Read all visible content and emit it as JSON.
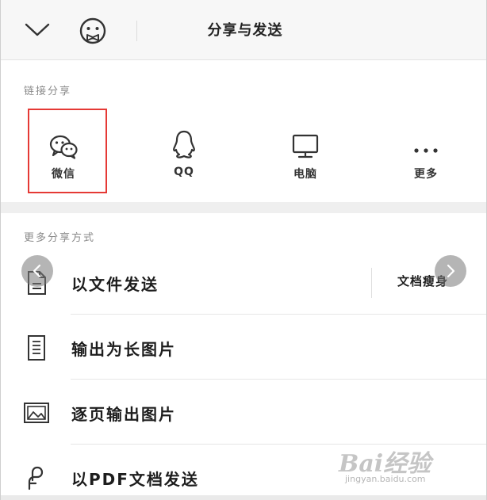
{
  "header": {
    "title": "分享与发送"
  },
  "link_share": {
    "section_label": "链接分享",
    "items": [
      {
        "label": "微信",
        "icon": "wechat-icon"
      },
      {
        "label": "QQ",
        "icon": "qq-icon"
      },
      {
        "label": "电脑",
        "icon": "monitor-icon"
      },
      {
        "label": "更多",
        "icon": "more-dots-icon"
      }
    ],
    "highlight_color": "#e53935"
  },
  "more_share": {
    "section_label": "更多分享方式",
    "items": [
      {
        "label": "以文件发送",
        "icon": "document-icon"
      },
      {
        "label": "输出为长图片",
        "icon": "long-image-icon"
      },
      {
        "label": "逐页输出图片",
        "icon": "picture-icon"
      },
      {
        "label": "以PDF文档发送",
        "icon": "pdf-icon"
      }
    ],
    "slim_button": "文档瘦身"
  },
  "watermark": {
    "brand": "Bai经验",
    "url": "jingyan.baidu.com"
  }
}
